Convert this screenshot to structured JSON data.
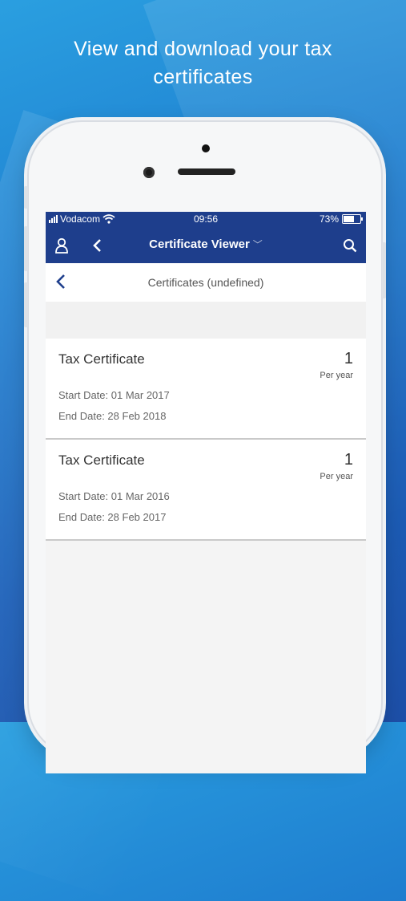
{
  "headline": {
    "line1": "View and download your tax",
    "line2": "certificates"
  },
  "status_bar": {
    "carrier": "Vodacom",
    "time": "09:56",
    "battery": "73%",
    "battery_level": 0.73
  },
  "nav": {
    "title": "Certificate Viewer",
    "icons": [
      "user-icon",
      "back-chevron-icon",
      "chevron-down-icon",
      "search-icon"
    ]
  },
  "subheader": {
    "title": "Certificates (undefined)"
  },
  "certificates": [
    {
      "name": "Tax Certificate",
      "count": "1",
      "period": "Per year",
      "start": "Start Date: 01 Mar 2017",
      "end": "End Date: 28 Feb 2018"
    },
    {
      "name": "Tax Certificate",
      "count": "1",
      "period": "Per year",
      "start": "Start Date: 01 Mar 2016",
      "end": "End Date: 28 Feb 2017"
    }
  ],
  "colors": {
    "nav_bar": "#1e3e8c",
    "accent": "#1e3e8c"
  }
}
